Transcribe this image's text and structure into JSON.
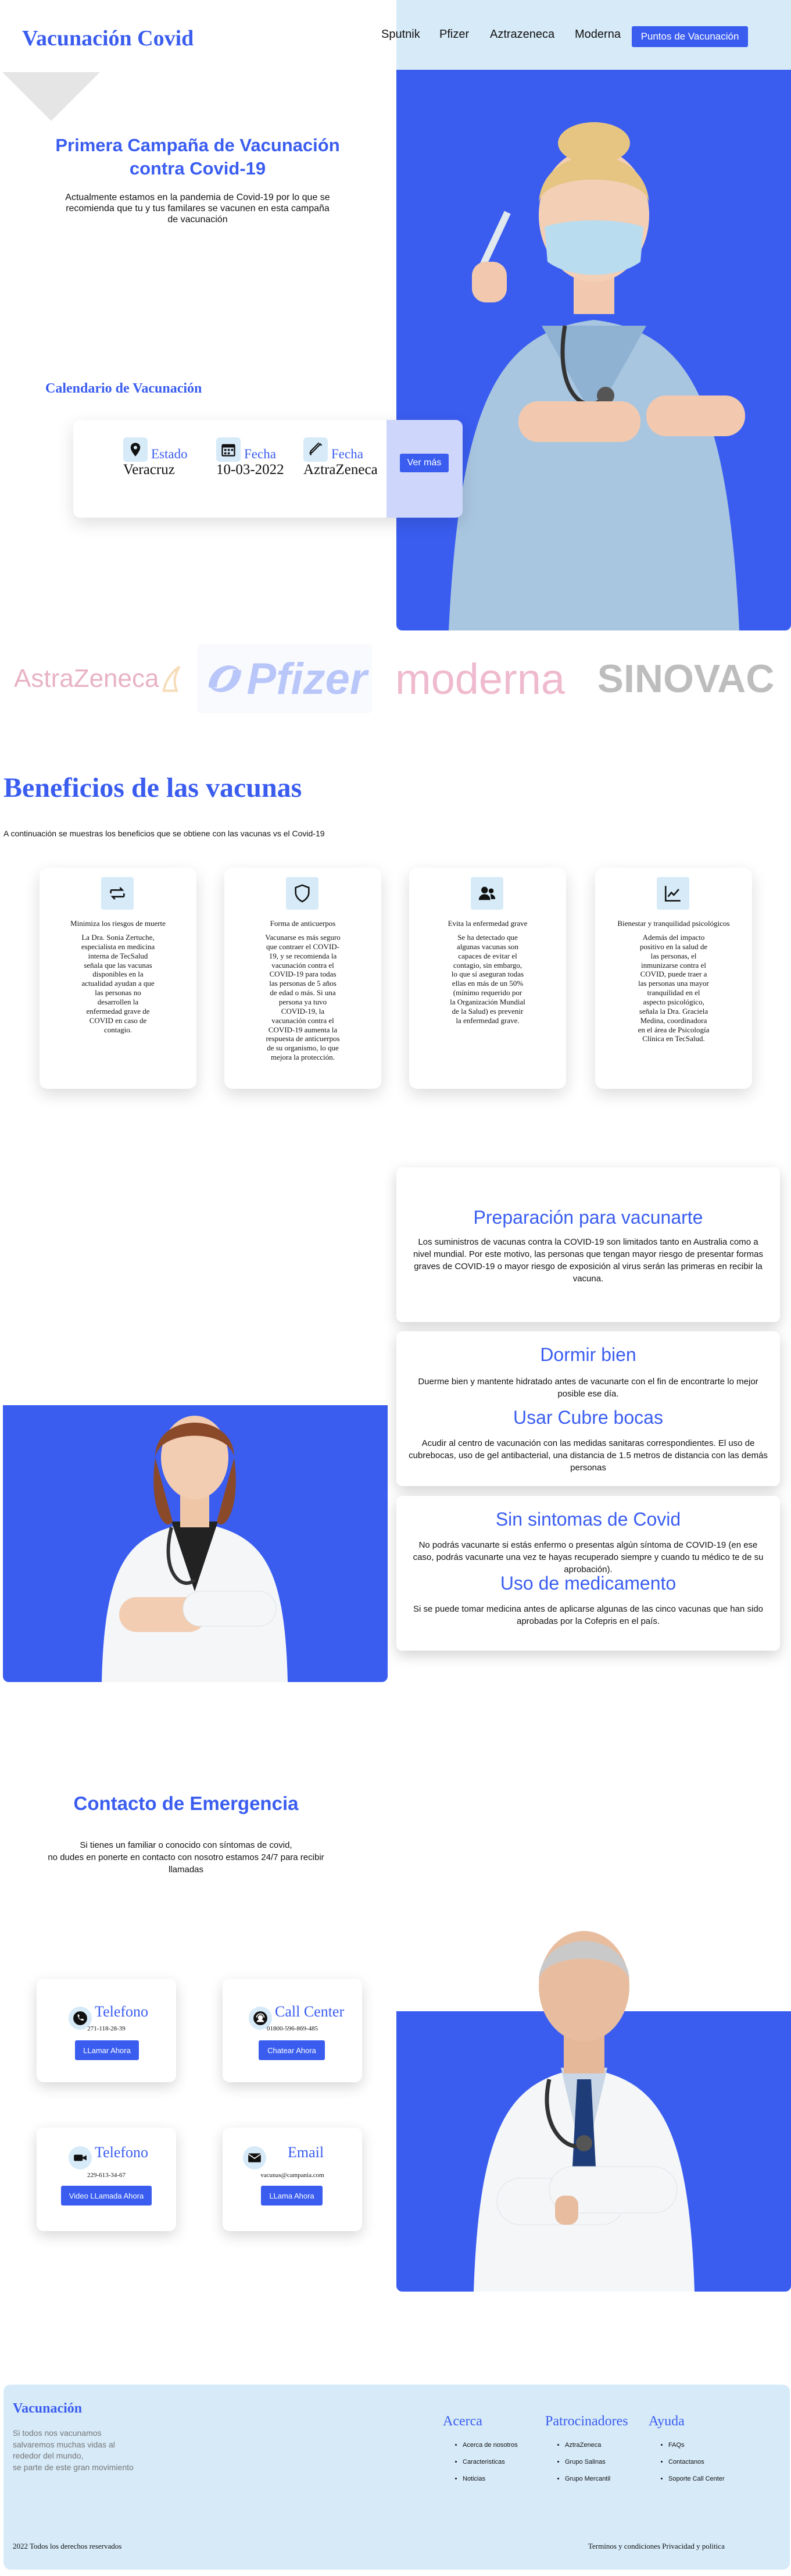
{
  "header": {
    "brand": "Vacunación Covid",
    "nav": [
      "Sputnik",
      "Pfizer",
      "Aztrazeneca",
      "Moderna"
    ],
    "cta": "Puntos de Vacunación"
  },
  "hero": {
    "title": "Primera Campaña de Vacunación contra Covid-19",
    "subtitle": "Actualmente estamos en la pandemia de Covid-19 por lo que se recomienda que tu y tus familares se vacunen en esta campaña de vacunación"
  },
  "calendar": {
    "title": "Calendario de Vacunación",
    "items": [
      {
        "icon": "location-pin-icon",
        "label": "Estado",
        "value": "Veracruz"
      },
      {
        "icon": "calendar-icon",
        "label": "Fecha",
        "value": "10-03-2022"
      },
      {
        "icon": "syringe-icon",
        "label": "Fecha",
        "value": "AztraZeneca"
      }
    ],
    "button": "Ver más"
  },
  "logos": [
    "AstraZeneca",
    "Pfizer",
    "moderna",
    "SINOVAC"
  ],
  "benefits": {
    "title": "Beneficios de las vacunas",
    "subtitle": "A continuación se muestras los beneficios que se obtiene con las vacunas vs el Covid-19",
    "cards": [
      {
        "icon": "exchange-arrows-icon",
        "title": "Minimiza los riesgos de muerte",
        "text": "La Dra. Sonia Zertuche, especialista en medicina interna de TecSalud señala que las vacunas disponibles en la actualidad ayudan a que las personas no desarrollen la enfermedad grave de COVID en caso de contagio."
      },
      {
        "icon": "shield-icon",
        "title": "Forma de anticuerpos",
        "text": "Vacunarse es más seguro que contraer el COVID-19, y se recomienda la vacunación contra el COVID-19 para todas las personas de 5 años de edad o más. Si una persona ya tuvo COVID-19, la vacunación contra el COVID-19 aumenta la respuesta de anticuerpos de su organismo, lo que mejora la protección."
      },
      {
        "icon": "people-icon",
        "title": "Evita la enfermedad grave",
        "text": "Se ha detectado que algunas vacunas son capaces de evitar el contagio, sin embargo, lo que sí aseguran todas ellas en más de un 50% (mínimo requerido por la Organización Mundial de la Salud) es prevenir la enfermedad grave."
      },
      {
        "icon": "chart-line-icon",
        "title": "Bienestar y tranquilidad psicológicos",
        "text": "Además del impacto positivo en la salud de las personas, el inmunizarse contra el COVID, puede traer a las personas una mayor tranquilidad en el aspecto psicológico, señala la Dra. Graciela Medina, coordinadora en el área de Psicología Clínica en TecSalud."
      }
    ]
  },
  "prep": {
    "cards": [
      {
        "sections": [
          {
            "title": "Preparación para vacunarte",
            "text": "Los suministros de vacunas contra la COVID-19 son limitados tanto en Australia como a nivel mundial. Por este motivo, las personas que tengan mayor riesgo de presentar formas graves de COVID-19 o mayor riesgo de exposición al virus serán las primeras en recibir la vacuna."
          }
        ]
      },
      {
        "sections": [
          {
            "title": "Dormir bien",
            "text": "Duerme bien y mantente hidratado antes de vacunarte con el fin de encontrarte lo mejor posible ese día."
          },
          {
            "title": "Usar Cubre bocas",
            "text": "Acudir al centro de vacunación con las medidas sanitaras correspondientes. El uso de cubrebocas, uso de gel antibacterial, una distancia de 1.5 metros de distancia con las demás personas"
          }
        ]
      },
      {
        "sections": [
          {
            "title": "Sin sintomas de Covid",
            "text": "No podrás vacunarte si estás enfermo o presentas algún síntoma de COVID-19 (en ese caso, podrás vacunarte una vez te hayas recuperado siempre y cuando tu médico te de su aprobación)."
          },
          {
            "title": "Uso de medicamento",
            "text": "Si se puede tomar medicina antes de aplicarse algunas de las cinco vacunas que han sido aprobadas por la Cofepris en el país."
          }
        ]
      }
    ]
  },
  "contact": {
    "title": "Contacto de Emergencia",
    "subtitle_line1": "Si tienes un familiar o conocido con síntomas de covid,",
    "subtitle_line2": "no dudes en ponerte en contacto con nosotro estamos 24/7 para recibir llamadas",
    "cards": [
      {
        "icon": "phone-icon",
        "title": "Telefono",
        "detail": "271-118-28-39",
        "button": "LLamar Ahora"
      },
      {
        "icon": "headset-icon",
        "title": "Call Center",
        "detail": "01800-596-869-485",
        "button": "Chatear Ahora"
      },
      {
        "icon": "video-camera-icon",
        "title": "Telefono",
        "detail": "229-613-34-67",
        "button": "Video LLamada Ahora"
      },
      {
        "icon": "envelope-icon",
        "title": "Email",
        "detail": "vacunas@campania.com",
        "button": "LLama Ahora"
      }
    ]
  },
  "footer": {
    "brand": "Vacunación",
    "desc_line1": "Si todos nos vacunamos",
    "desc_line2": "salvaremos muchas vidas al",
    "desc_line3": "rededor del mundo,",
    "desc_line4": "se parte de este gran movimiento",
    "columns": [
      {
        "title": "Acerca",
        "items": [
          "Acerca de nosotros",
          "Caracteristicas",
          "Noticias"
        ]
      },
      {
        "title": "Patrocinadores",
        "items": [
          "AztraZeneca",
          "Grupo Salinas",
          "Grupo Mercantil"
        ]
      },
      {
        "title": "Ayuda",
        "items": [
          "FAQs",
          "Contactanos",
          "Soporte Call Center"
        ]
      }
    ],
    "copyright": "2022 Todos los derechos reservados",
    "terms": "Terminos y condiciones  Privacidad y politica"
  },
  "colors": {
    "accent": "#3a5df0",
    "light": "#d6eaf8"
  }
}
